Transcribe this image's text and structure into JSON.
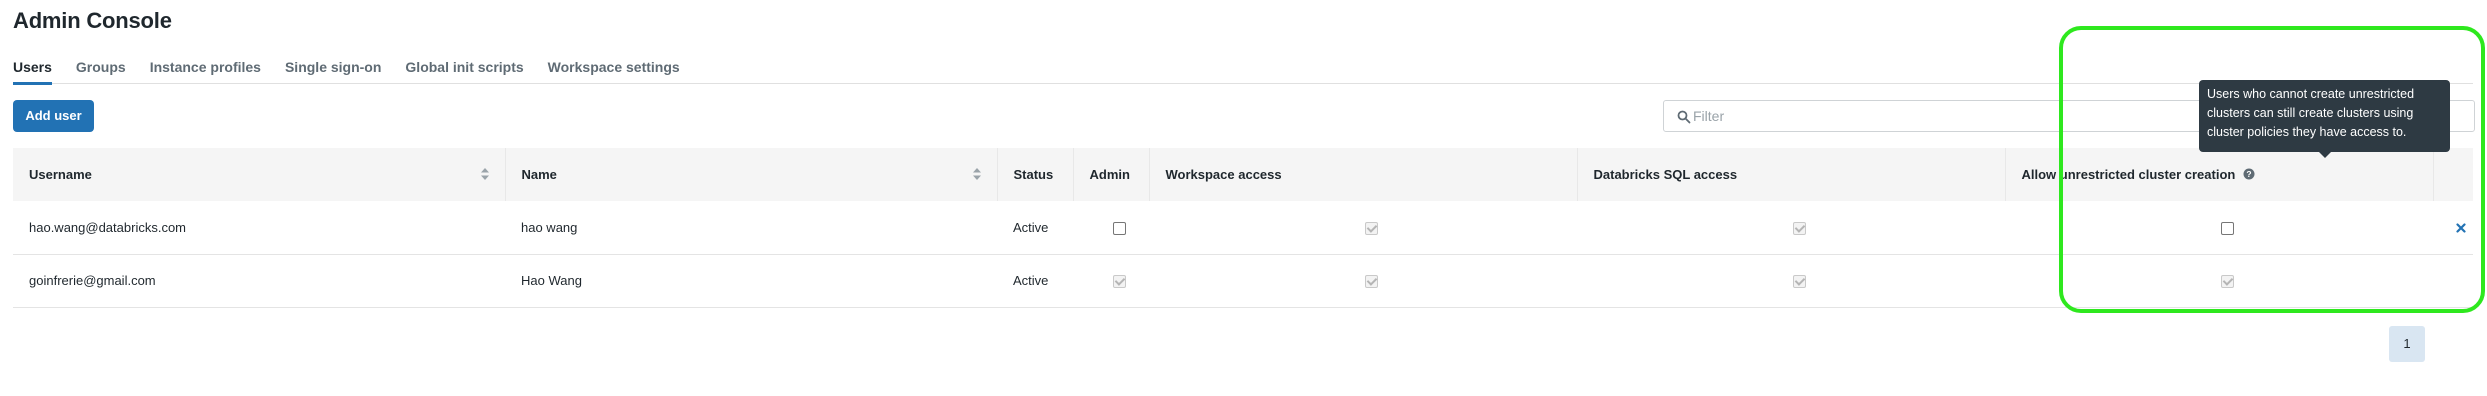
{
  "page": {
    "title": "Admin Console"
  },
  "tabs": [
    {
      "label": "Users",
      "active": true
    },
    {
      "label": "Groups",
      "active": false
    },
    {
      "label": "Instance profiles",
      "active": false
    },
    {
      "label": "Single sign-on",
      "active": false
    },
    {
      "label": "Global init scripts",
      "active": false
    },
    {
      "label": "Workspace settings",
      "active": false
    }
  ],
  "toolbar": {
    "add_user_label": "Add user"
  },
  "filter": {
    "placeholder": "Filter",
    "value": "",
    "icon": "search-icon"
  },
  "table": {
    "columns": {
      "username": "Username",
      "name": "Name",
      "status": "Status",
      "admin": "Admin",
      "workspace_access": "Workspace access",
      "sql_access": "Databricks SQL access",
      "cluster_creation": "Allow unrestricted cluster creation"
    },
    "rows": [
      {
        "username": "hao.wang@databricks.com",
        "name": "hao wang",
        "status": "Active",
        "admin": "unchecked",
        "workspace_access": "checked-disabled",
        "sql_access": "checked-disabled",
        "cluster_creation": "unchecked",
        "removable": true
      },
      {
        "username": "goinfrerie@gmail.com",
        "name": "Hao Wang",
        "status": "Active",
        "admin": "checked-disabled",
        "workspace_access": "checked-disabled",
        "sql_access": "checked-disabled",
        "cluster_creation": "checked-disabled",
        "removable": false
      }
    ]
  },
  "tooltip": {
    "text": "Users who cannot create unrestricted clusters can still create clusters using cluster policies they have access to."
  },
  "pagination": {
    "current_page": "1"
  },
  "colors": {
    "accent": "#2272b4",
    "highlight": "#2ee81e",
    "tooltip_bg": "#2e3a43",
    "header_bg": "#f5f5f5"
  }
}
